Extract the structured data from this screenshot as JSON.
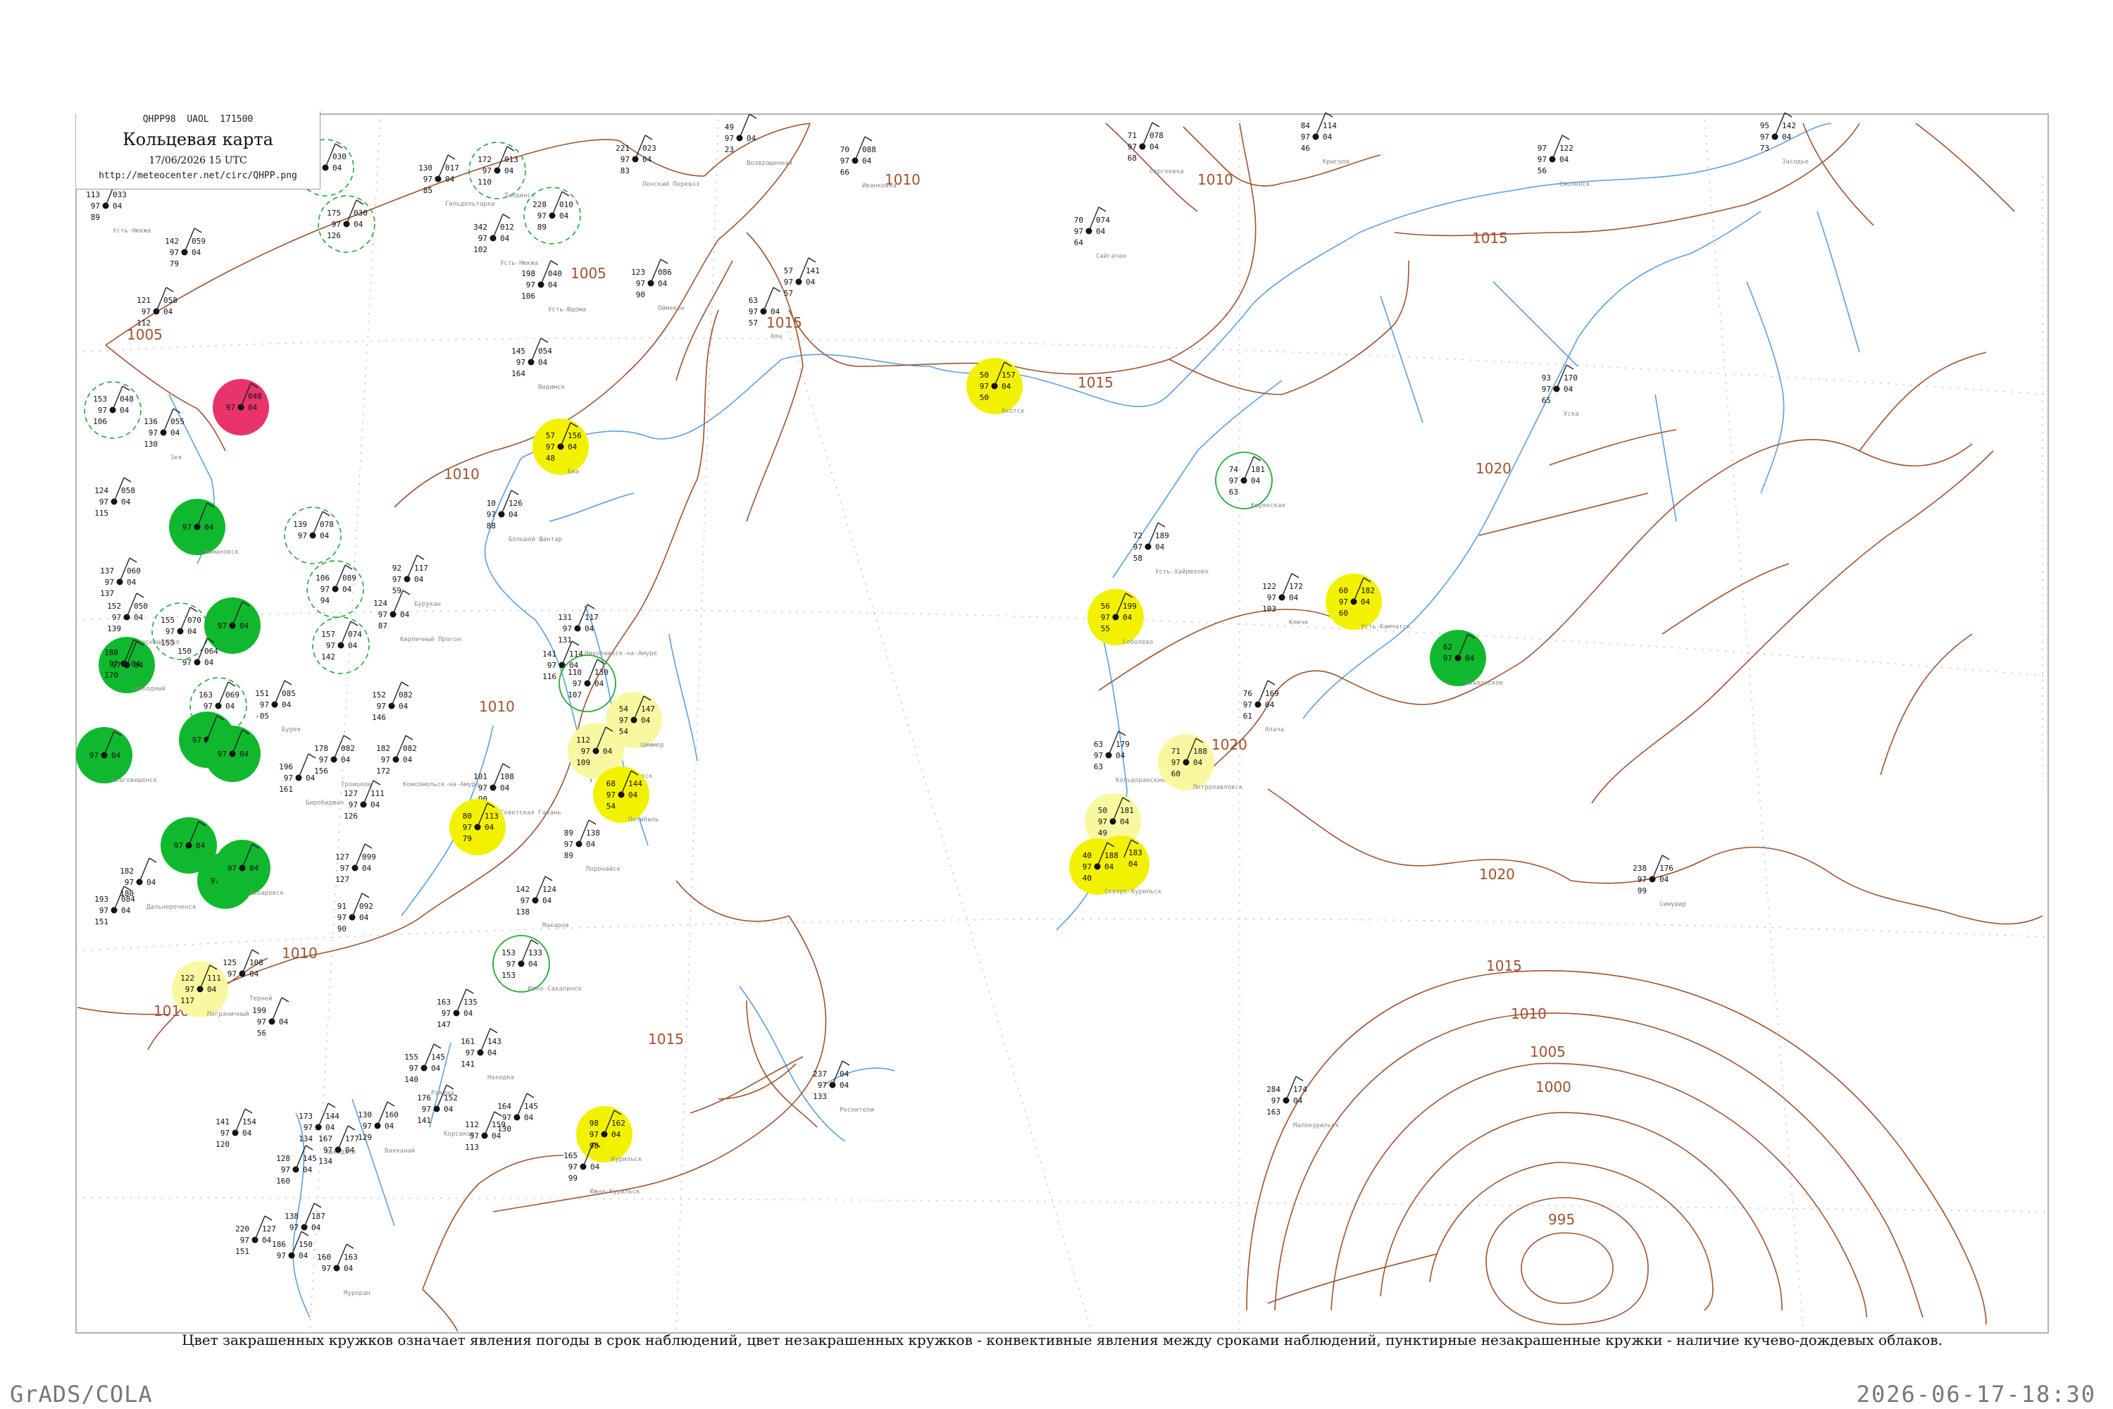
{
  "header": {
    "code": "QHPP98  UAOL  171500",
    "title": "Кольцевая карта",
    "time": "17/06/2026 15 UTC",
    "url": "http://meteocenter.net/circ/QHPP.png"
  },
  "caption": "Цвет закрашенных кружков означает явления погоды в срок наблюдений, цвет незакрашенных кружков - конвективные явления между сроками наблюдений, пунктирные незакрашенные кружки - наличие кучево-дождевых облаков.",
  "footer": {
    "left": "GrADS/COLA",
    "right": "2026-06-17-18:30"
  },
  "colors": {
    "isobar": "#a0522d",
    "river": "#5aa0e0",
    "grid": "#b0b0b0",
    "red": "#e8336b",
    "green": "#10b82e",
    "yellow": "#f2f200",
    "paleYellow": "#f8f8a0",
    "greenDash": "#22aa33"
  },
  "isobar_labels": [
    "1005",
    "1005",
    "1010",
    "1010",
    "1010",
    "1010",
    "1010",
    "1010",
    "1015",
    "1015",
    "1015",
    "1015",
    "1020",
    "1020",
    "1020",
    "1015",
    "1010",
    "1005",
    "1000",
    "995"
  ],
  "stations": [
    {
      "color": "none",
      "pressure": "033",
      "temp": "113",
      "dew": "89",
      "name": "Усть-Нюкжа"
    },
    {
      "color": "none",
      "pressure": "059",
      "temp": "142",
      "dew": "79",
      "name": ""
    },
    {
      "color": "none",
      "pressure": "058",
      "temp": "121",
      "dew": "112",
      "name": ""
    },
    {
      "color": "greenDash",
      "pressure": "030",
      "temp": "151",
      "dew": "103",
      "name": ""
    },
    {
      "color": "greenDash",
      "pressure": "030",
      "temp": "175",
      "dew": "126",
      "name": ""
    },
    {
      "color": "greenDash",
      "pressure": "013",
      "temp": "172",
      "dew": "110",
      "name": "Тындинск"
    },
    {
      "color": "greenDash",
      "pressure": "010",
      "temp": "228",
      "dew": "89",
      "name": ""
    },
    {
      "color": "none",
      "pressure": "017",
      "temp": "130",
      "dew": "85",
      "name": "Гильдельтарка"
    },
    {
      "color": "none",
      "pressure": "012",
      "temp": "342",
      "dew": "102",
      "name": "Усть-Нюкжа"
    },
    {
      "color": "none",
      "pressure": "040",
      "temp": "198",
      "dew": "106",
      "name": "Усть-Юдома"
    },
    {
      "color": "none",
      "pressure": "023",
      "temp": "221",
      "dew": "83",
      "name": "Ленский Перевоз"
    },
    {
      "color": "none",
      "pressure": "086",
      "temp": "123",
      "dew": "90",
      "name": "Оймякон"
    },
    {
      "color": "none",
      "pressure": "",
      "temp": "49",
      "dew": "23",
      "name": "Возвращенная"
    },
    {
      "color": "none",
      "pressure": "088",
      "temp": "70",
      "dew": "66",
      "name": "Иванковка"
    },
    {
      "color": "none",
      "pressure": "078",
      "temp": "71",
      "dew": "68",
      "name": "Сергеевка"
    },
    {
      "color": "none",
      "pressure": "074",
      "temp": "70",
      "dew": "64",
      "name": "Сайгачан"
    },
    {
      "color": "none",
      "pressure": "114",
      "temp": "84",
      "dew": "46",
      "name": "Крыгола"
    },
    {
      "color": "none",
      "pressure": "122",
      "temp": "97",
      "dew": "56",
      "name": "Смоленск"
    },
    {
      "color": "none",
      "pressure": "142",
      "temp": "95",
      "dew": "73",
      "name": "Засодье"
    },
    {
      "color": "none",
      "pressure": "141",
      "temp": "57",
      "dew": "57",
      "name": ""
    },
    {
      "color": "none",
      "pressure": "",
      "temp": "63",
      "dew": "57",
      "name": "Аян"
    },
    {
      "color": "none",
      "pressure": "054",
      "temp": "145",
      "dew": "164",
      "name": "Видимск"
    },
    {
      "color": "greenDash",
      "pressure": "048",
      "temp": "153",
      "dew": "106",
      "name": ""
    },
    {
      "color": "red",
      "pressure": "048",
      "temp": "",
      "dew": "",
      "name": ""
    },
    {
      "color": "none",
      "pressure": "055",
      "temp": "136",
      "dew": "130",
      "name": "Зея"
    },
    {
      "color": "yellow",
      "pressure": "156",
      "temp": "57",
      "dew": "48",
      "name": "Биа"
    },
    {
      "color": "yellow",
      "pressure": "157",
      "temp": "50",
      "dew": "50",
      "name": "Охотск"
    },
    {
      "color": "none",
      "pressure": "170",
      "temp": "93",
      "dew": "65",
      "name": "Уска"
    },
    {
      "color": "green",
      "pressure": "",
      "temp": "",
      "dew": "",
      "name": "Шимановск"
    },
    {
      "color": "none",
      "pressure": "058",
      "temp": "124",
      "dew": "115",
      "name": ""
    },
    {
      "color": "none",
      "pressure": "126",
      "temp": "10",
      "dew": "88",
      "name": "Большой Шантар"
    },
    {
      "color": "none",
      "pressure": "189",
      "temp": "72",
      "dew": "58",
      "name": "Усть-Хайрюзово"
    },
    {
      "color": "greenPlain",
      "pressure": "181",
      "temp": "74",
      "dew": "63",
      "name": "Корякская"
    },
    {
      "color": "greenDash",
      "pressure": "078",
      "temp": "139",
      "dew": "",
      "name": ""
    },
    {
      "color": "greenDash",
      "pressure": "089",
      "temp": "106",
      "dew": "94",
      "name": ""
    },
    {
      "color": "none",
      "pressure": "117",
      "temp": "92",
      "dew": "59",
      "name": "Бурукан"
    },
    {
      "color": "none",
      "pressure": "",
      "temp": "124",
      "dew": "87",
      "name": "Кирпичный Прогон"
    },
    {
      "color": "none",
      "pressure": "060",
      "temp": "137",
      "dew": "137",
      "name": ""
    },
    {
      "color": "green",
      "pressure": "",
      "temp": "",
      "dew": "",
      "name": ""
    },
    {
      "color": "greenDash",
      "pressure": "070",
      "temp": "155",
      "dew": "155",
      "name": ""
    },
    {
      "color": "none",
      "pressure": "050",
      "temp": "152",
      "dew": "139",
      "name": "Краснощёково"
    },
    {
      "color": "green",
      "pressure": "",
      "temp": "",
      "dew": "",
      "name": ""
    },
    {
      "color": "greenDash",
      "pressure": "074",
      "temp": "157",
      "dew": "142",
      "name": ""
    },
    {
      "color": "none",
      "pressure": "",
      "temp": "180",
      "dew": "170",
      "name": "Свободный"
    },
    {
      "color": "none",
      "pressure": "064",
      "temp": "150",
      "dew": "",
      "name": ""
    },
    {
      "color": "none",
      "pressure": "117",
      "temp": "131",
      "dew": "131",
      "name": "Николаевск-на-Амуре"
    },
    {
      "color": "none",
      "pressure": "114",
      "temp": "141",
      "dew": "116",
      "name": ""
    },
    {
      "color": "greenPlain",
      "pressure": "130",
      "temp": "110",
      "dew": "107",
      "name": ""
    },
    {
      "color": "paleYellow",
      "pressure": "147",
      "temp": "54",
      "dew": "54",
      "name": "Циммер"
    },
    {
      "color": "yellow",
      "pressure": "199",
      "temp": "56",
      "dew": "55",
      "name": "Соболево"
    },
    {
      "color": "yellow",
      "pressure": "182",
      "temp": "60",
      "dew": "60",
      "name": "Усть-Камчатск"
    },
    {
      "color": "none",
      "pressure": "172",
      "temp": "122",
      "dew": "103",
      "name": "Ключи"
    },
    {
      "color": "green",
      "pressure": "",
      "temp": "62",
      "dew": "",
      "name": "Никольское"
    },
    {
      "color": "none",
      "pressure": "082",
      "temp": "152",
      "dew": "146",
      "name": ""
    },
    {
      "color": "none",
      "pressure": "085",
      "temp": "151",
      "dew": "-05",
      "name": "Бурея"
    },
    {
      "color": "greenDash",
      "pressure": "069",
      "temp": "163",
      "dew": "",
      "name": ""
    },
    {
      "color": "green",
      "pressure": "",
      "temp": "",
      "dew": "",
      "name": ""
    },
    {
      "color": "green",
      "pressure": "",
      "temp": "",
      "dew": "",
      "name": ""
    },
    {
      "color": "green",
      "pressure": "",
      "temp": "",
      "dew": "",
      "name": "Благовещенск"
    },
    {
      "color": "none",
      "pressure": "082",
      "temp": "182",
      "dew": "172",
      "name": "Комсомольск-на-Амуре"
    },
    {
      "color": "none",
      "pressure": "082",
      "temp": "178",
      "dew": "156",
      "name": "Троицкое"
    },
    {
      "color": "none",
      "pressure": "",
      "temp": "196",
      "dew": "161",
      "name": "Биробиджан"
    },
    {
      "color": "none",
      "pressure": "111",
      "temp": "127",
      "dew": "126",
      "name": ""
    },
    {
      "color": "paleYellow",
      "pressure": "",
      "temp": "112",
      "dew": "109",
      "name": "Александровск"
    },
    {
      "color": "yellow",
      "pressure": "144",
      "temp": "68",
      "dew": "54",
      "name": "Погибиль"
    },
    {
      "color": "none",
      "pressure": "108",
      "temp": "101",
      "dew": "90",
      "name": "Советская Гавань"
    },
    {
      "color": "yellow",
      "pressure": "113",
      "temp": "80",
      "dew": "79",
      "name": ""
    },
    {
      "color": "none",
      "pressure": "179",
      "temp": "63",
      "dew": "63",
      "name": "Кольдоранский"
    },
    {
      "color": "paleYellow",
      "pressure": "188",
      "temp": "71",
      "dew": "60",
      "name": "Петропавловск"
    },
    {
      "color": "none",
      "pressure": "169",
      "temp": "76",
      "dew": "61",
      "name": "Апача"
    },
    {
      "color": "paleYellow",
      "pressure": "181",
      "temp": "50",
      "dew": "49",
      "name": ""
    },
    {
      "color": "yellow",
      "pressure": "183",
      "temp": "",
      "dew": "",
      "name": ""
    },
    {
      "color": "yellow",
      "pressure": "188",
      "temp": "40",
      "dew": "40",
      "name": "Северо-Курильск"
    },
    {
      "color": "none",
      "pressure": "138",
      "temp": "89",
      "dew": "89",
      "name": "Поронайск"
    },
    {
      "color": "none",
      "pressure": "124",
      "temp": "142",
      "dew": "138",
      "name": "Макаров"
    },
    {
      "color": "none",
      "pressure": "099",
      "temp": "127",
      "dew": "127",
      "name": ""
    },
    {
      "color": "green",
      "pressure": "",
      "temp": "",
      "dew": "",
      "name": ""
    },
    {
      "color": "green",
      "pressure": "",
      "temp": "",
      "dew": "",
      "name": ""
    },
    {
      "color": "green",
      "pressure": "",
      "temp": "",
      "dew": "",
      "name": "Хабаровск"
    },
    {
      "color": "none",
      "pressure": "",
      "temp": "182",
      "dew": "180",
      "name": "Дальнереченск"
    },
    {
      "color": "none",
      "pressure": "084",
      "temp": "193",
      "dew": "151",
      "name": ""
    },
    {
      "color": "none",
      "pressure": "092",
      "temp": "91",
      "dew": "90",
      "name": ""
    },
    {
      "color": "greenPlain",
      "pressure": "133",
      "temp": "153",
      "dew": "153",
      "name": "Южно-Сахалинск"
    },
    {
      "color": "none",
      "pressure": "108",
      "temp": "125",
      "dew": "",
      "name": "Терней"
    },
    {
      "color": "paleYellow",
      "pressure": "111",
      "temp": "122",
      "dew": "117",
      "name": "Пограничный"
    },
    {
      "color": "none",
      "pressure": "176",
      "temp": "238",
      "dew": "99",
      "name": "Симушир"
    },
    {
      "color": "none",
      "pressure": "135",
      "temp": "163",
      "dew": "147",
      "name": ""
    },
    {
      "color": "none",
      "pressure": "",
      "temp": "199",
      "dew": "56",
      "name": ""
    },
    {
      "color": "none",
      "pressure": "143",
      "temp": "161",
      "dew": "141",
      "name": "Находка"
    },
    {
      "color": "none",
      "pressure": "145",
      "temp": "155",
      "dew": "140",
      "name": "Ракуша"
    },
    {
      "color": "none",
      "pressure": "04",
      "temp": "237",
      "dew": "133",
      "name": "Реснители"
    },
    {
      "color": "yellow",
      "pressure": "162",
      "temp": "98",
      "dew": "98",
      "name": "Курильск"
    },
    {
      "color": "none",
      "pressure": "",
      "temp": "165",
      "dew": "99",
      "name": "Южно-Курильск"
    },
    {
      "color": "none",
      "pressure": "174",
      "temp": "284",
      "dew": "163",
      "name": "Малокурильск"
    },
    {
      "color": "none",
      "pressure": "152",
      "temp": "176",
      "dew": "141",
      "name": "Корсаков"
    },
    {
      "color": "none",
      "pressure": "145",
      "temp": "164",
      "dew": "130",
      "name": ""
    },
    {
      "color": "none",
      "pressure": "159",
      "temp": "112",
      "dew": "113",
      "name": ""
    },
    {
      "color": "none",
      "pressure": "160",
      "temp": "130",
      "dew": "129",
      "name": "Вакканай"
    },
    {
      "color": "none",
      "pressure": "144",
      "temp": "173",
      "dew": "134",
      "name": "Хакодате"
    },
    {
      "color": "none",
      "pressure": "154",
      "temp": "141",
      "dew": "120",
      "name": ""
    },
    {
      "color": "none",
      "pressure": "177",
      "temp": "167",
      "dew": "134",
      "name": ""
    },
    {
      "color": "none",
      "pressure": "145",
      "temp": "128",
      "dew": "160",
      "name": ""
    },
    {
      "color": "none",
      "pressure": "187",
      "temp": "138",
      "dew": "",
      "name": ""
    },
    {
      "color": "none",
      "pressure": "127",
      "temp": "220",
      "dew": "151",
      "name": ""
    },
    {
      "color": "none",
      "pressure": "150",
      "temp": "186",
      "dew": "",
      "name": ""
    },
    {
      "color": "none",
      "pressure": "163",
      "temp": "160",
      "dew": "",
      "name": "Муроран"
    }
  ]
}
